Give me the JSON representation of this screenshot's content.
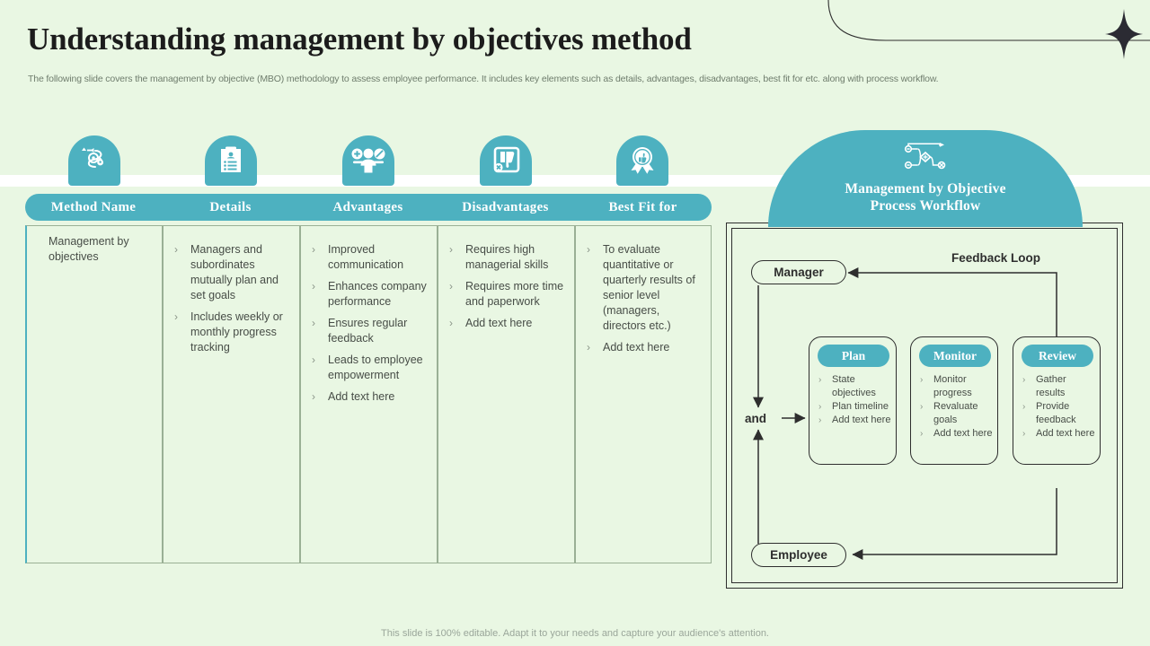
{
  "page": {
    "title": "Understanding management by objectives method",
    "subtitle": "The following slide covers the management by objective (MBO) methodology to assess employee performance. It includes key elements such as details, advantages, disadvantages, best fit for etc. along with process workflow.",
    "footer": "This slide is 100% editable. Adapt it to your needs and capture your audience's attention."
  },
  "colors": {
    "background": "#e9f7e3",
    "accent": "#4db1c0",
    "band": "#ffffff",
    "text": "#474d47",
    "title": "#1c1c1c",
    "stroke": "#2e2e2e"
  },
  "table": {
    "columns": [
      {
        "header": "Method Name",
        "icon": "process-cycle-icon",
        "type": "plain",
        "text": "Management by objectives",
        "items": []
      },
      {
        "header": "Details",
        "icon": "clipboard-list-icon",
        "type": "bullets",
        "items": [
          "Managers and subordinates mutually plan and set goals",
          "Includes weekly or monthly progress tracking"
        ]
      },
      {
        "header": "Advantages",
        "icon": "people-plus-icon",
        "type": "bullets",
        "items": [
          "Improved communication",
          "Enhances company performance",
          "Ensures regular feedback",
          "Leads to employee empowerment",
          "Add text here"
        ]
      },
      {
        "header": "Disadvantages",
        "icon": "thumbs-down-icon",
        "type": "bullets",
        "items": [
          "Requires high managerial skills",
          "Requires more time and paperwork",
          "Add text here"
        ]
      },
      {
        "header": "Best Fit for",
        "icon": "award-badge-icon",
        "type": "bullets",
        "items": [
          "To evaluate quantitative or quarterly results of senior level (managers, directors etc.)",
          "Add text here"
        ]
      }
    ]
  },
  "workflow": {
    "icon": "flow-diagram-icon",
    "title_line1": "Management by Objective",
    "title_line2": "Process Workflow",
    "manager_label": "Manager",
    "employee_label": "Employee",
    "and_label": "and",
    "feedback_label": "Feedback Loop",
    "stages": [
      {
        "title": "Plan",
        "items": [
          "State objectives",
          "Plan timeline",
          "Add text here"
        ]
      },
      {
        "title": "Monitor",
        "items": [
          "Monitor progress",
          "Revaluate goals",
          "Add text here"
        ]
      },
      {
        "title": "Review",
        "items": [
          "Gather results",
          "Provide feedback",
          "Add text here"
        ]
      }
    ]
  }
}
